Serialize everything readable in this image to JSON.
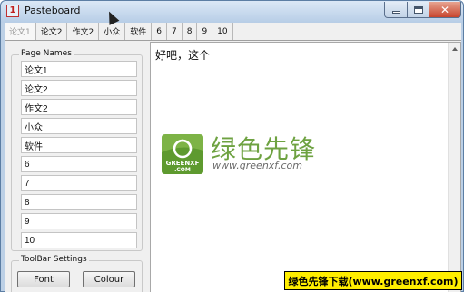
{
  "window": {
    "title": "Pasteboard",
    "app_icon_text": "1",
    "close_glyph": "✕"
  },
  "tabs": [
    "论文1",
    "论文2",
    "作文2",
    "小众",
    "软件",
    "6",
    "7",
    "8",
    "9",
    "10"
  ],
  "active_tab": 0,
  "page_names": {
    "legend": "Page Names",
    "items": [
      "论文1",
      "论文2",
      "作文2",
      "小众",
      "软件",
      "6",
      "7",
      "8",
      "9",
      "10"
    ]
  },
  "toolbar_settings": {
    "legend": "ToolBar Settings",
    "font_label": "Font",
    "colour_label": "Colour"
  },
  "editor": {
    "content": "好吧，这个"
  },
  "watermark": {
    "logo_text_line1": "GREENXF",
    "logo_text_line2": ".COM",
    "chinese": "绿色先锋",
    "url": "www.greenxf.com",
    "color": "#6ea241"
  },
  "banner": {
    "text": "绿色先锋下载(www.greenxf.com)",
    "color": "#ffee00"
  }
}
